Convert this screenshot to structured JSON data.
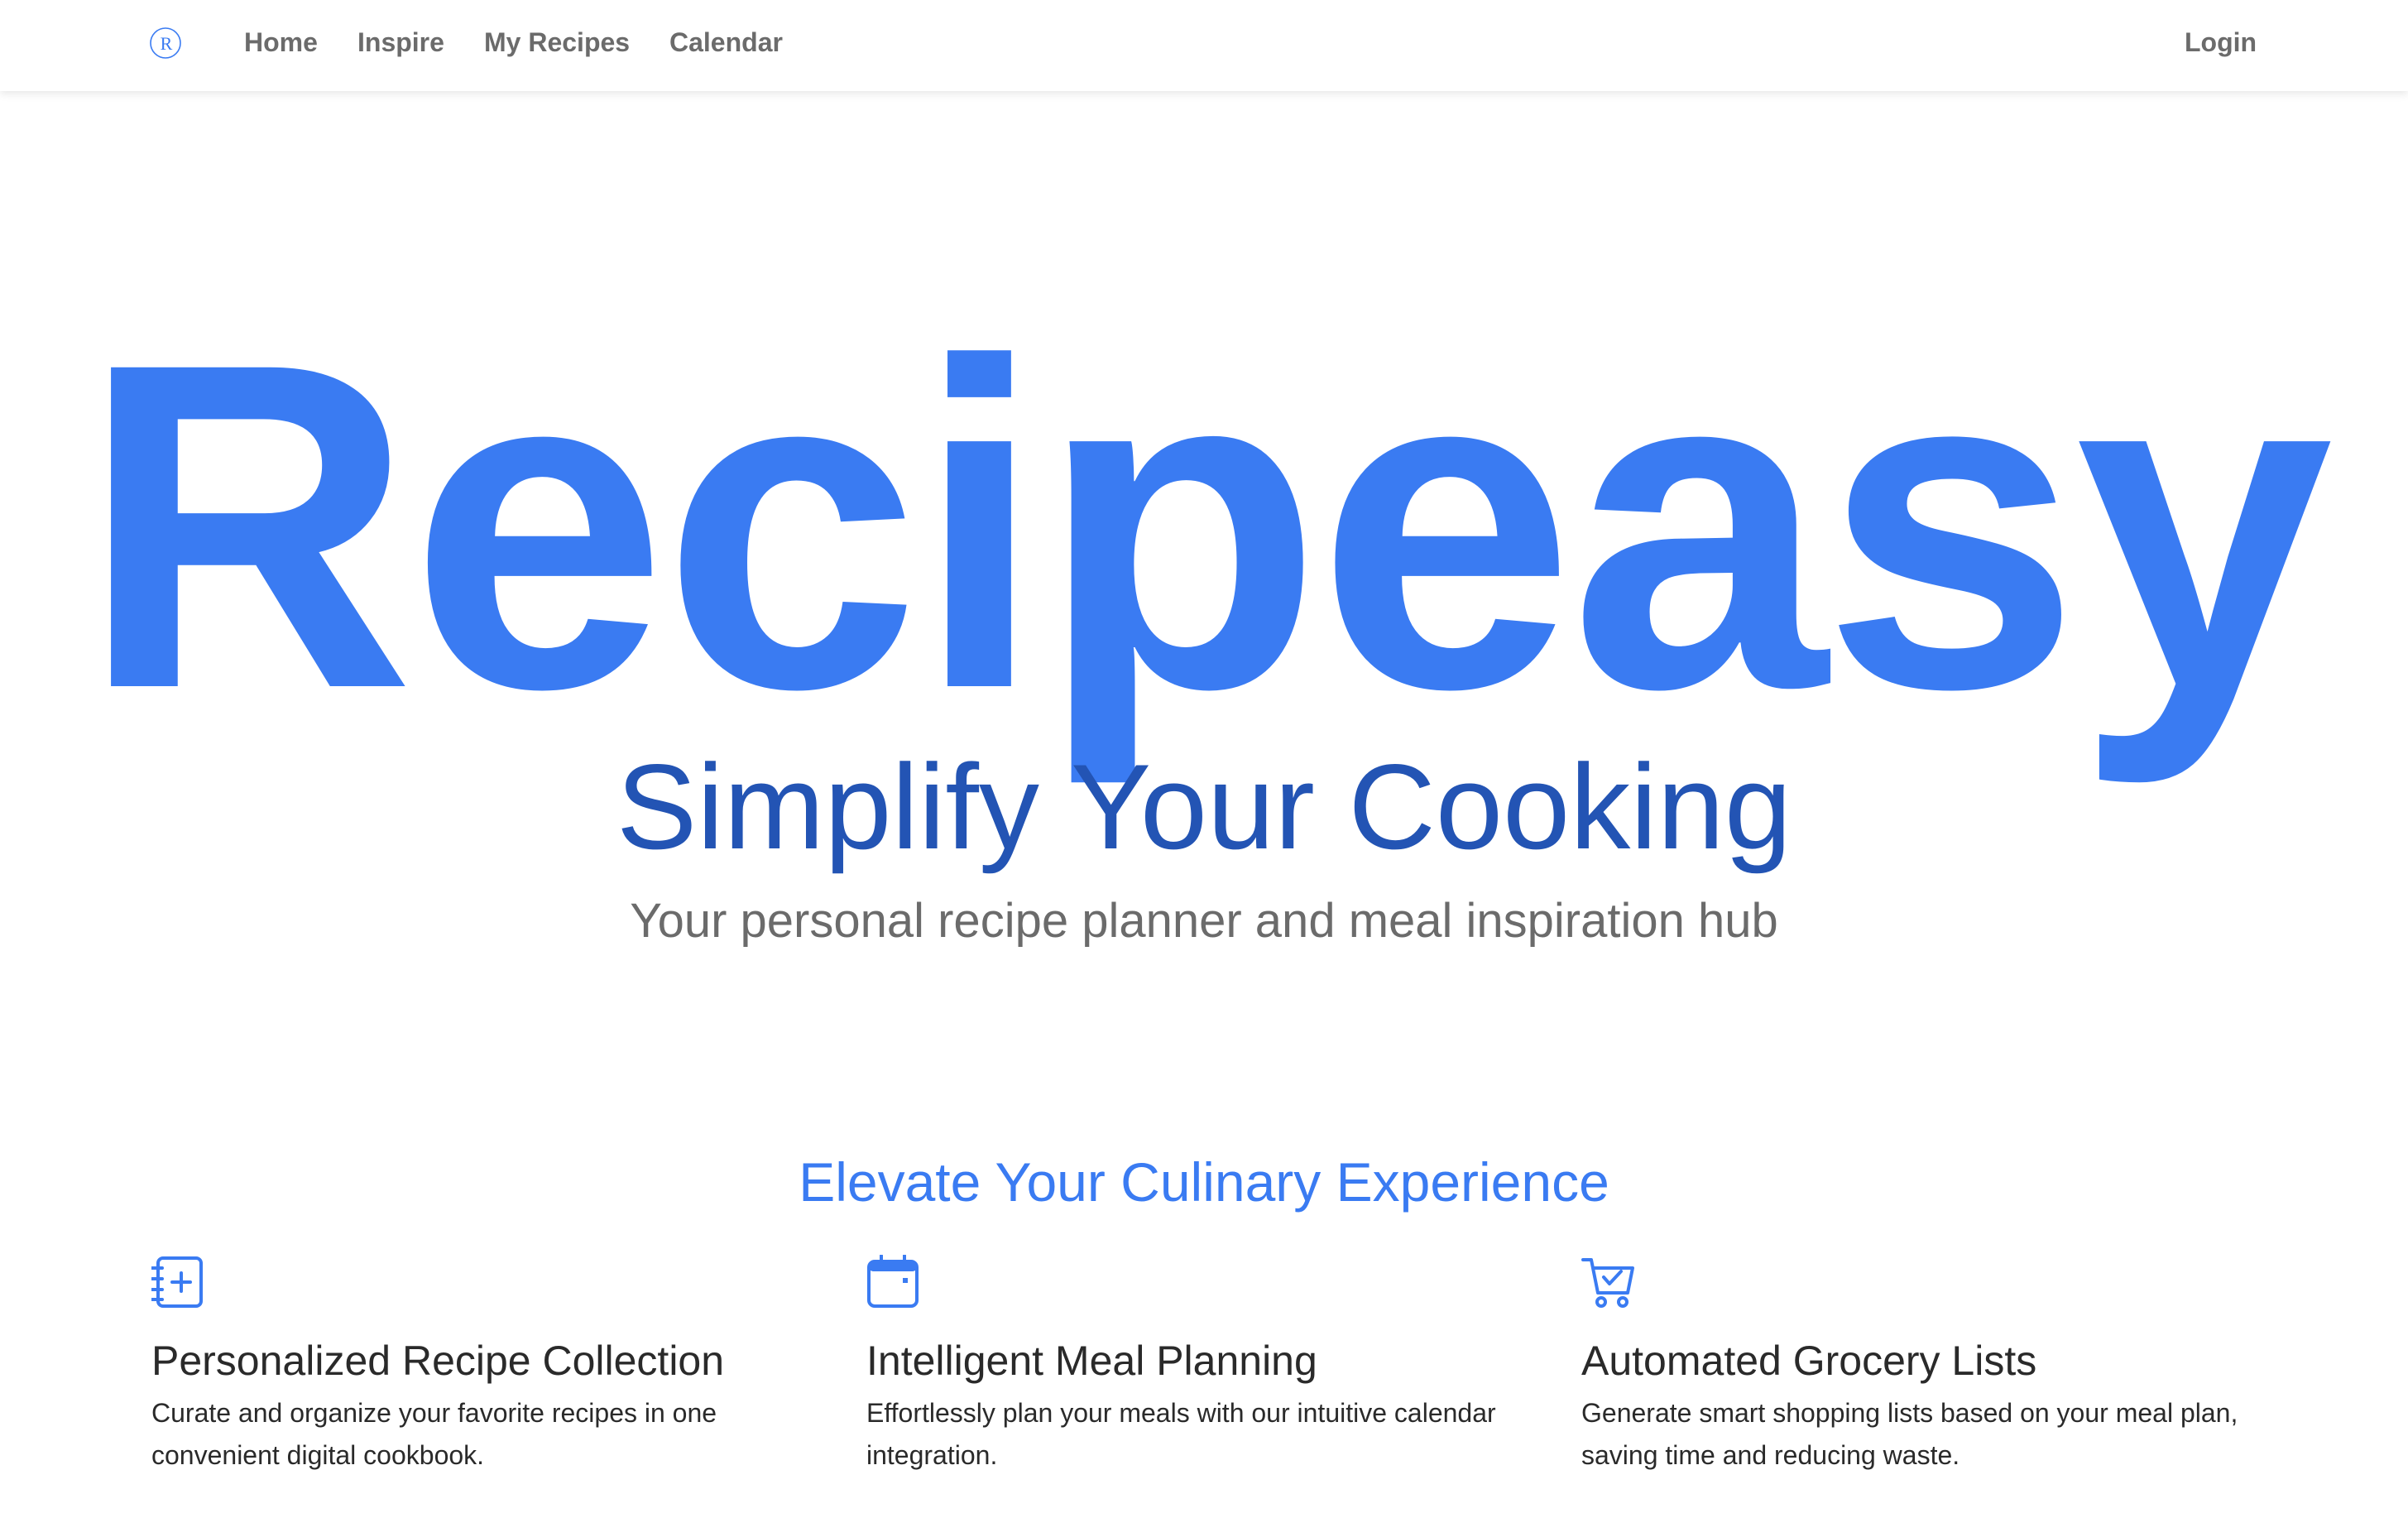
{
  "nav": {
    "logo_letter": "R",
    "links": [
      "Home",
      "Inspire",
      "My Recipes",
      "Calendar"
    ],
    "login_label": "Login"
  },
  "hero": {
    "title": "Recipeasy",
    "subtitle": "Simplify Your Cooking",
    "tagline": "Your personal recipe planner and meal inspiration hub"
  },
  "features_section": {
    "heading": "Elevate Your Culinary Experience",
    "items": [
      {
        "icon": "notebook-plus-icon",
        "title": "Personalized Recipe Collection",
        "description": "Curate and organize your favorite recipes in one convenient digital cookbook."
      },
      {
        "icon": "calendar-icon",
        "title": "Intelligent Meal Planning",
        "description": "Effortlessly plan your meals with our intuitive calendar integration."
      },
      {
        "icon": "shopping-cart-check-icon",
        "title": "Automated Grocery Lists",
        "description": "Generate smart shopping lists based on your meal plan, saving time and reducing waste."
      }
    ]
  },
  "colors": {
    "brand_blue": "#3a7bf2",
    "subtitle_blue": "#2354b4",
    "nav_gray": "#6b6b6b",
    "text_dark": "#2a2a2a"
  }
}
